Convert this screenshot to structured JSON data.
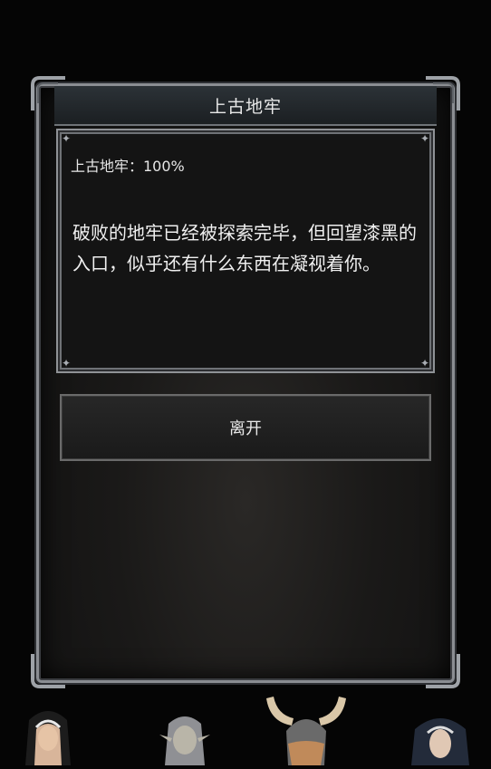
{
  "dialog": {
    "title": "上古地牢",
    "progress_label": "上古地牢：100%",
    "description": "破败的地牢已经被探索完毕，但回望漆黑的入口，似乎还有什么东西在凝视着你。",
    "leave_button": "离开"
  },
  "party": [
    "nun-hero-portrait",
    "elf-hero-portrait",
    "horned-warrior-portrait",
    "hooded-priestess-portrait"
  ]
}
